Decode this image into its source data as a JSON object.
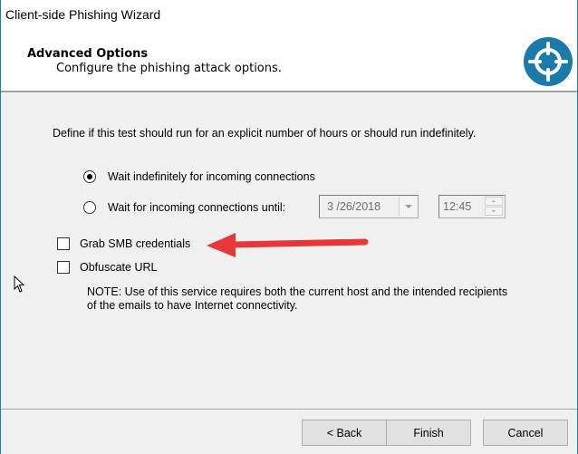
{
  "window": {
    "title": "Client-side Phishing Wizard"
  },
  "header": {
    "title": "Advanced Options",
    "subtitle": "Configure the phishing attack options.",
    "logo_icon": "crosshair-target-icon",
    "logo_color": "#1a7bab"
  },
  "content": {
    "description": "Define if this test should run for an explicit number of hours or should run indefinitely.",
    "radio_options": [
      {
        "label": "Wait indefinitely for incoming connections",
        "checked": true
      },
      {
        "label": "Wait for incoming connections until:",
        "checked": false
      }
    ],
    "date_value": "3 /26/2018",
    "time_value": "12:45",
    "checkboxes": [
      {
        "label": "Grab SMB credentials",
        "checked": false
      },
      {
        "label": "Obfuscate URL",
        "checked": false
      }
    ],
    "note": "NOTE: Use of this service requires both the current host and the intended recipients of the emails to have Internet connectivity.",
    "annotation_arrow_color": "#e8373a"
  },
  "footer": {
    "back_label": "< Back",
    "finish_label": "Finish",
    "cancel_label": "Cancel"
  }
}
